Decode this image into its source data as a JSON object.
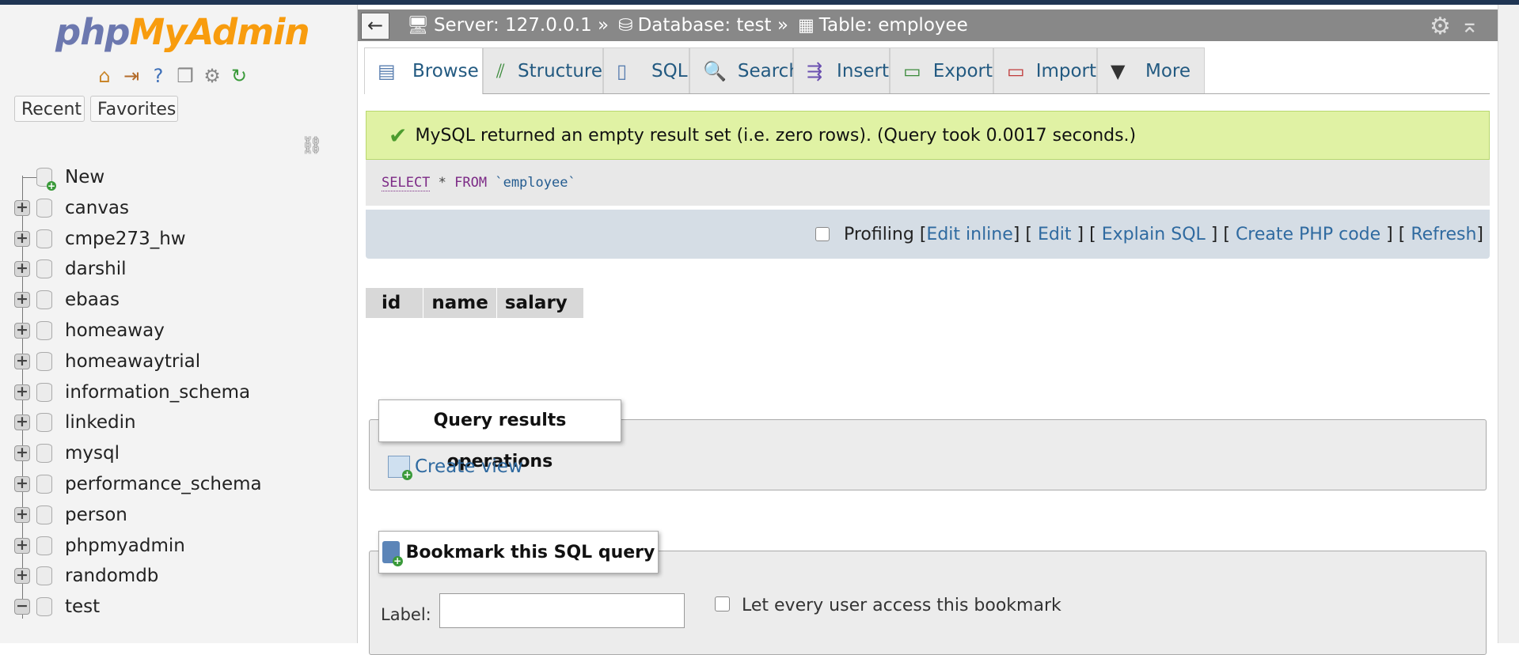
{
  "logo": {
    "part1": "php",
    "part2": "MyAdmin"
  },
  "logo_icons": [
    "home-icon",
    "logout-icon",
    "help-icon",
    "docs-icon",
    "settings-icon",
    "reload-icon"
  ],
  "sidebar": {
    "recent_label": "Recent",
    "favorites_label": "Favorites",
    "tree": [
      {
        "label": "New",
        "kind": "new"
      },
      {
        "label": "canvas",
        "kind": "collapsed"
      },
      {
        "label": "cmpe273_hw",
        "kind": "collapsed"
      },
      {
        "label": "darshil",
        "kind": "collapsed"
      },
      {
        "label": "ebaas",
        "kind": "collapsed"
      },
      {
        "label": "homeaway",
        "kind": "collapsed"
      },
      {
        "label": "homeawaytrial",
        "kind": "collapsed"
      },
      {
        "label": "information_schema",
        "kind": "collapsed"
      },
      {
        "label": "linkedin",
        "kind": "collapsed"
      },
      {
        "label": "mysql",
        "kind": "collapsed"
      },
      {
        "label": "performance_schema",
        "kind": "collapsed"
      },
      {
        "label": "person",
        "kind": "collapsed"
      },
      {
        "label": "phpmyadmin",
        "kind": "collapsed"
      },
      {
        "label": "randomdb",
        "kind": "collapsed"
      },
      {
        "label": "test",
        "kind": "expanded"
      }
    ]
  },
  "header": {
    "back_glyph": "←",
    "server": "Server: 127.0.0.1 »",
    "database": "Database: test »",
    "table": "Table: employee"
  },
  "tabs": [
    {
      "label": "Browse",
      "icon": "browse-icon",
      "active": true
    },
    {
      "label": "Structure",
      "icon": "structure-icon",
      "active": false
    },
    {
      "label": "SQL",
      "icon": "sql-icon",
      "active": false
    },
    {
      "label": "Search",
      "icon": "search-icon",
      "active": false
    },
    {
      "label": "Insert",
      "icon": "insert-icon",
      "active": false
    },
    {
      "label": "Export",
      "icon": "export-icon",
      "active": false
    },
    {
      "label": "Import",
      "icon": "import-icon",
      "active": false
    },
    {
      "label": "More",
      "icon": "dropdown-icon",
      "active": false
    }
  ],
  "message": "MySQL returned an empty result set (i.e. zero rows). (Query took 0.0017 seconds.)",
  "sql": {
    "kw_select": "SELECT",
    "star": " * ",
    "kw_from": "FROM",
    "table": "`employee`"
  },
  "tools": {
    "profiling": "Profiling",
    "edit_inline": "Edit inline",
    "edit": "Edit",
    "explain": "Explain SQL",
    "php": "Create PHP code",
    "refresh": "Refresh"
  },
  "result_columns": [
    "id",
    "name",
    "salary"
  ],
  "query_ops": {
    "legend": "Query results operations",
    "create_view": "Create view"
  },
  "bookmark": {
    "legend": "Bookmark this SQL query",
    "label_text": "Label:",
    "label_value": "",
    "share_text": "Let every user access this bookmark"
  },
  "colors": {
    "brand_blue": "#6c78af",
    "brand_orange": "#f89c0e",
    "link": "#2f6aa0",
    "success_bg": "#e0f2a4"
  }
}
